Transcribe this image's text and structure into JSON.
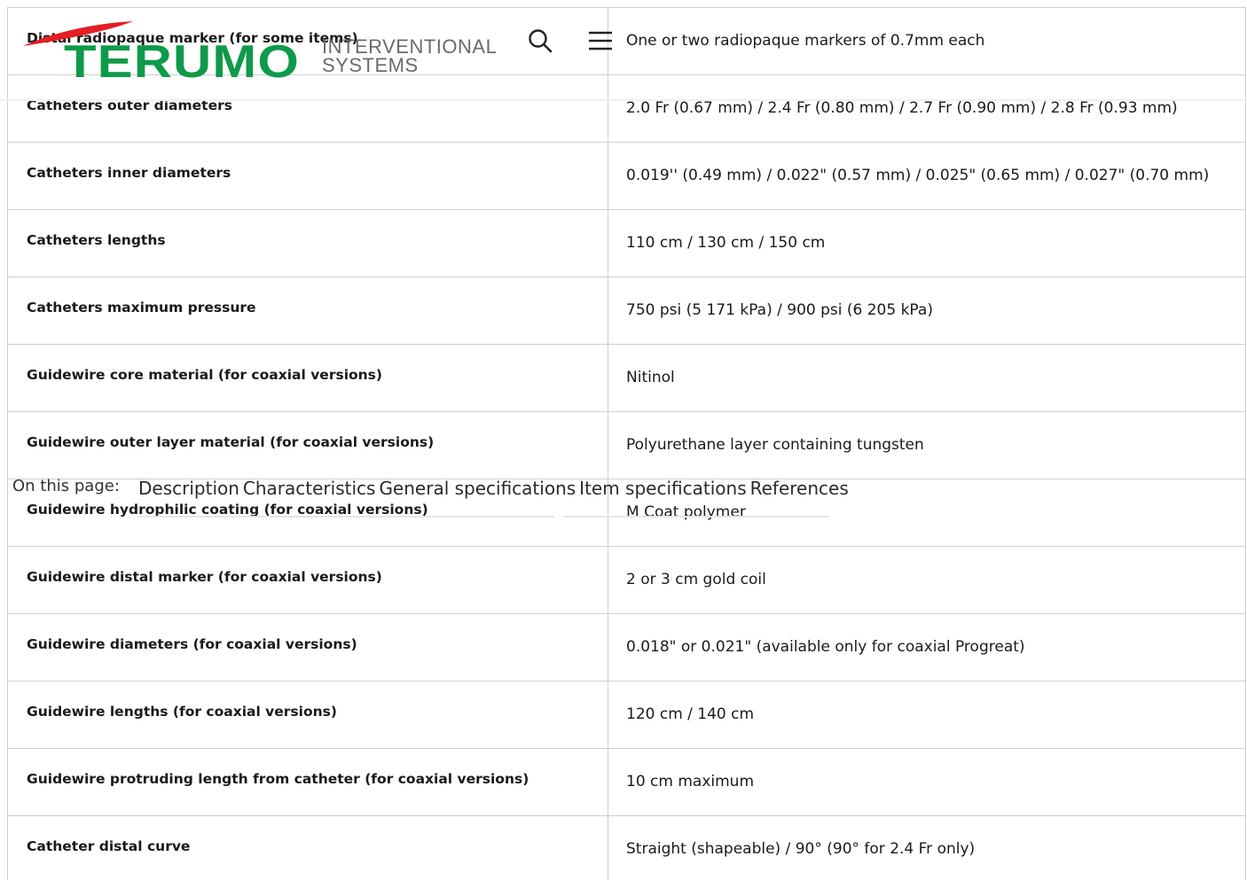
{
  "header": {
    "logo_word": "TERUMO",
    "logo_sub_line1": "INTERVENTIONAL",
    "logo_sub_line2": "SYSTEMS",
    "logo_colors": {
      "green": "#0e9a4a",
      "red": "#e31e24",
      "gray": "#6a6a6a"
    }
  },
  "on_this_page": {
    "label": "On this page:",
    "links": [
      "Description",
      "Characteristics",
      "General specifications",
      "Item specifications",
      "References"
    ]
  },
  "specs": [
    {
      "label": "Distal radiopaque marker (for some items)",
      "value": "One or two radiopaque markers of 0.7mm each"
    },
    {
      "label": "Catheters outer diameters",
      "value": "2.0 Fr (0.67 mm) / 2.4 Fr (0.80 mm) / 2.7 Fr (0.90 mm) / 2.8 Fr (0.93 mm)"
    },
    {
      "label": "Catheters inner diameters",
      "value": "0.019'' (0.49 mm) / 0.022\" (0.57 mm) / 0.025\" (0.65 mm) / 0.027\" (0.70 mm)"
    },
    {
      "label": "Catheters lengths",
      "value": "110 cm / 130 cm / 150 cm"
    },
    {
      "label": "Catheters maximum pressure",
      "value": "750 psi (5 171 kPa) / 900 psi (6 205 kPa)"
    },
    {
      "label": "Guidewire core material (for coaxial versions)",
      "value": "Nitinol"
    },
    {
      "label": "Guidewire outer layer material (for coaxial versions)",
      "value": "Polyurethane layer containing tungsten"
    },
    {
      "label": "Guidewire hydrophilic coating (for coaxial versions)",
      "value": "M Coat polymer"
    },
    {
      "label": "Guidewire distal marker (for coaxial versions)",
      "value": "2 or 3 cm gold coil"
    },
    {
      "label": "Guidewire diameters (for coaxial versions)",
      "value": "0.018\" or 0.021\" (available only for coaxial Progreat)"
    },
    {
      "label": "Guidewire lengths (for coaxial versions)",
      "value": "120 cm / 140 cm"
    },
    {
      "label": "Guidewire protruding length from catheter (for coaxial versions)",
      "value": "10 cm maximum"
    },
    {
      "label": "Catheter distal curve",
      "value": "Straight (shapeable) / 90° (90° for 2.4 Fr only)"
    }
  ]
}
